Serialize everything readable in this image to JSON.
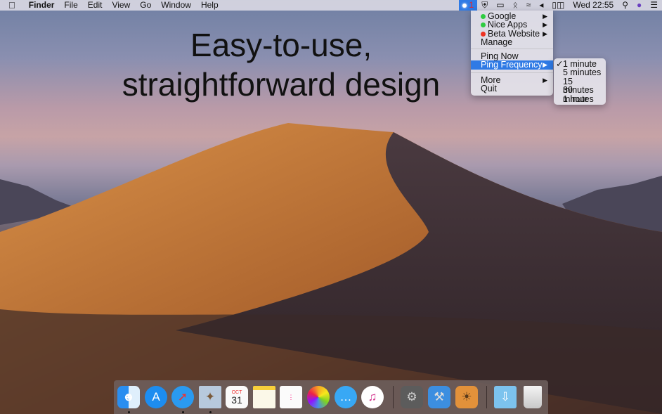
{
  "menubar": {
    "app": "Finder",
    "items": [
      "File",
      "Edit",
      "View",
      "Go",
      "Window",
      "Help"
    ],
    "badge": "1",
    "clock": "Wed 22:55"
  },
  "headline": {
    "line1": "Easy-to-use,",
    "line2": "straightforward design"
  },
  "menu": {
    "sites": [
      {
        "label": "Google",
        "status": "#2ecc40"
      },
      {
        "label": "Nice Apps",
        "status": "#2ecc40"
      },
      {
        "label": "Beta Website",
        "status": "#ee3322"
      }
    ],
    "manage": "Manage",
    "ping_now": "Ping Now",
    "ping_frequency": "Ping Frequency",
    "more": "More",
    "quit": "Quit"
  },
  "submenu": {
    "options": [
      "1 minute",
      "5 minutes",
      "15 minutes",
      "30 minutes",
      "1 hour"
    ],
    "selected": "1 minute"
  },
  "dock": {
    "apps": [
      "Finder",
      "App Store",
      "Safari",
      "Mail",
      "Calendar",
      "Notes",
      "Reminders",
      "Photos",
      "Messages",
      "iTunes",
      "System Preferences",
      "Xcode",
      "Preview",
      "Downloads",
      "Trash"
    ],
    "calendar_month": "OCT",
    "calendar_day": "31"
  }
}
